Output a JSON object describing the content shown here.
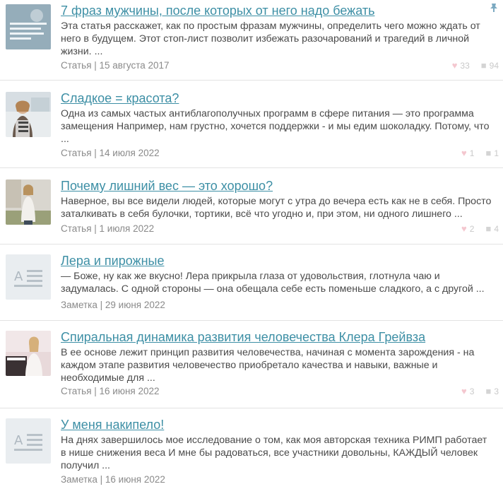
{
  "posts": [
    {
      "title": "7 фраз мужчины, после которых от него надо бежать",
      "excerpt": "Эта статья расскажет, как по простым фразам мужчины, определить чего можно ждать от него в будущем. Этот стоп-лист позволит избежать разочарований и трагедий в личной жизни. ...",
      "meta": "Статья | 15 августа 2017",
      "likes": "33",
      "comments": "94",
      "thumb_text": "7 фраз мужчины, после которых от него надо бежать",
      "pinned": true
    },
    {
      "title": "Сладкое = красота?",
      "excerpt": "Одна из самых частых антиблагополучных программ в сфере питания — это программа замещения Например, нам грустно, хочется поддержки - и мы едим шоколадку. Потому, что ...",
      "meta": "Статья | 14 июля 2022",
      "likes": "1",
      "comments": "1"
    },
    {
      "title": "Почему лишний вес — это хорошо?",
      "excerpt": "Наверное, вы все видели людей, которые могут с утра до вечера есть как не в себя. Просто заталкивать в себя булочки, тортики, всё что угодно и, при этом, ни одного лишнего ...",
      "meta": "Статья | 1 июля 2022",
      "likes": "2",
      "comments": "4"
    },
    {
      "title": "Лера и пирожные",
      "excerpt": "— Боже, ну как же вкусно! Лера прикрыла глаза от удовольствия, глотнула чаю и задумалась. С одной стороны — она обещала себе есть поменьше сладкого, а с другой ...",
      "meta": "Заметка | 29 июня 2022"
    },
    {
      "title": "Спиральная динамика развития человечества Клера Грейвза",
      "excerpt": "В ее основе лежит принцип развития человечества, начиная с момента зарождения - на каждом этапе развития человечество приобретало качества и навыки, важные и необходимые для ...",
      "meta": "Статья | 16 июня 2022",
      "likes": "3",
      "comments": "3"
    },
    {
      "title": "У меня накипело!",
      "excerpt": "На днях завершилось мое исследование о том, как моя авторская техника РИМП работает в нише снижения веса И мне бы радоваться, все участники довольны, КАЖДЫЙ человек получил ...",
      "meta": "Заметка | 16 июня 2022"
    }
  ],
  "icons": {
    "like": "heart-icon",
    "comment": "comment-icon",
    "pin": "pin-icon",
    "note": "note-placeholder-icon"
  },
  "colors": {
    "title": "#3d8fa5",
    "text": "#4a4a4a",
    "meta": "#8a8a8a",
    "like": "#f4c7cf",
    "divider": "#e3e3e3"
  }
}
